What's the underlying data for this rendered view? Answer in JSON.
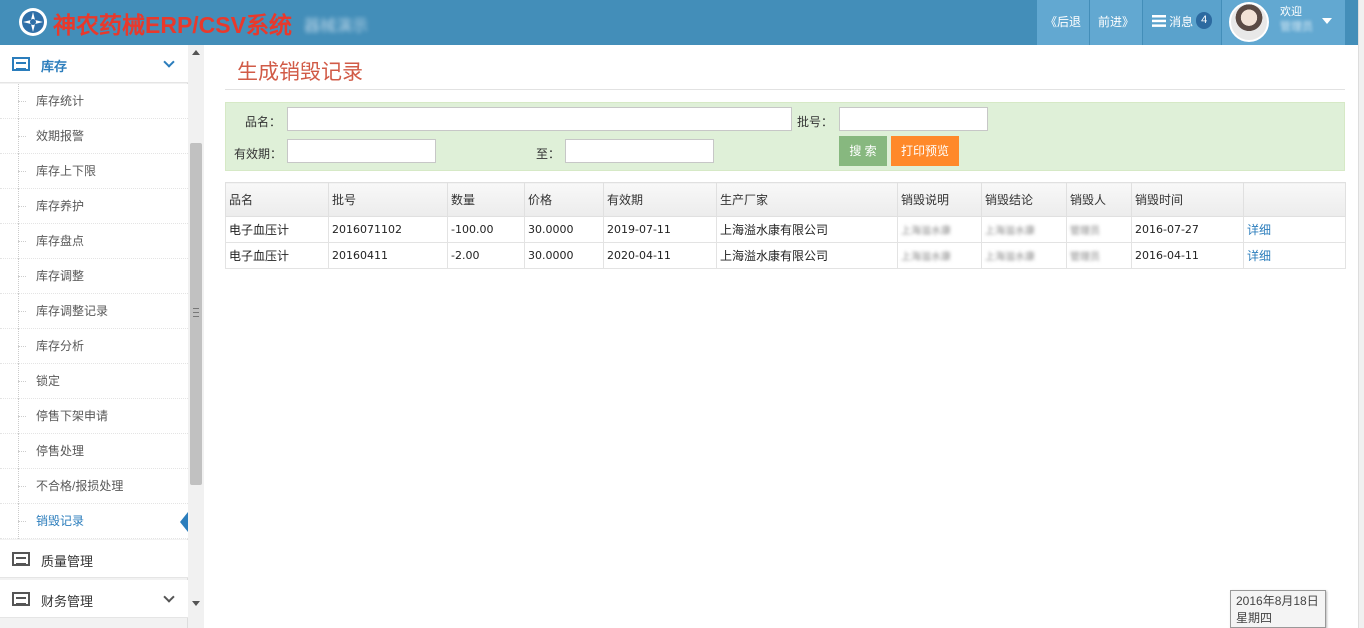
{
  "header": {
    "app_title": "神农药械ERP/CSV系统",
    "app_subtitle": "器械演示",
    "nav_back": "《后退",
    "nav_forward": "前进》",
    "messages_label": "消息",
    "messages_count": "4",
    "welcome": "欢迎",
    "username": "管理员"
  },
  "sidebar": {
    "inventory": {
      "label": "库存",
      "items": [
        "库存统计",
        "效期报警",
        "库存上下限",
        "库存养护",
        "库存盘点",
        "库存调整",
        "库存调整记录",
        "库存分析",
        "锁定",
        "停售下架申请",
        "停售处理",
        "不合格/报损处理",
        "销毁记录"
      ],
      "active_item": "销毁记录"
    },
    "quality": {
      "label": "质量管理"
    },
    "finance": {
      "label": "财务管理"
    }
  },
  "page": {
    "title": "生成销毁记录"
  },
  "search": {
    "name_label": "品名：",
    "name_value": "",
    "batch_label": "批号：",
    "batch_value": "",
    "expiry_label": "有效期：",
    "expiry_from": "",
    "to_label": "至：",
    "expiry_to": "",
    "search_button": "搜 索",
    "print_button": "打印预览"
  },
  "table": {
    "columns": [
      "品名",
      "批号",
      "数量",
      "价格",
      "有效期",
      "生产厂家",
      "销毁说明",
      "销毁结论",
      "销毁人",
      "销毁时间",
      ""
    ],
    "rows": [
      [
        "电子血压计",
        "2016071102",
        "-100.00",
        "30.0000",
        "2019-07-11",
        "上海溢水康有限公司",
        "上海溢水康",
        "上海溢水康",
        "管理员",
        "2016-07-27",
        "详细"
      ],
      [
        "电子血压计",
        "20160411",
        "-2.00",
        "30.0000",
        "2020-04-11",
        "上海溢水康有限公司",
        "上海溢水康",
        "上海溢水康",
        "管理员",
        "2016-04-11",
        "详细"
      ]
    ]
  },
  "datebox": {
    "date": "2016年8月18日",
    "weekday": "星期四"
  },
  "colors": {
    "header_bg": "#438eb9",
    "title_red": "#d15b47",
    "search_bg": "#dff0d8",
    "search_btn": "#87b87f",
    "print_btn": "#ff892a",
    "link": "#2b7dbc"
  }
}
